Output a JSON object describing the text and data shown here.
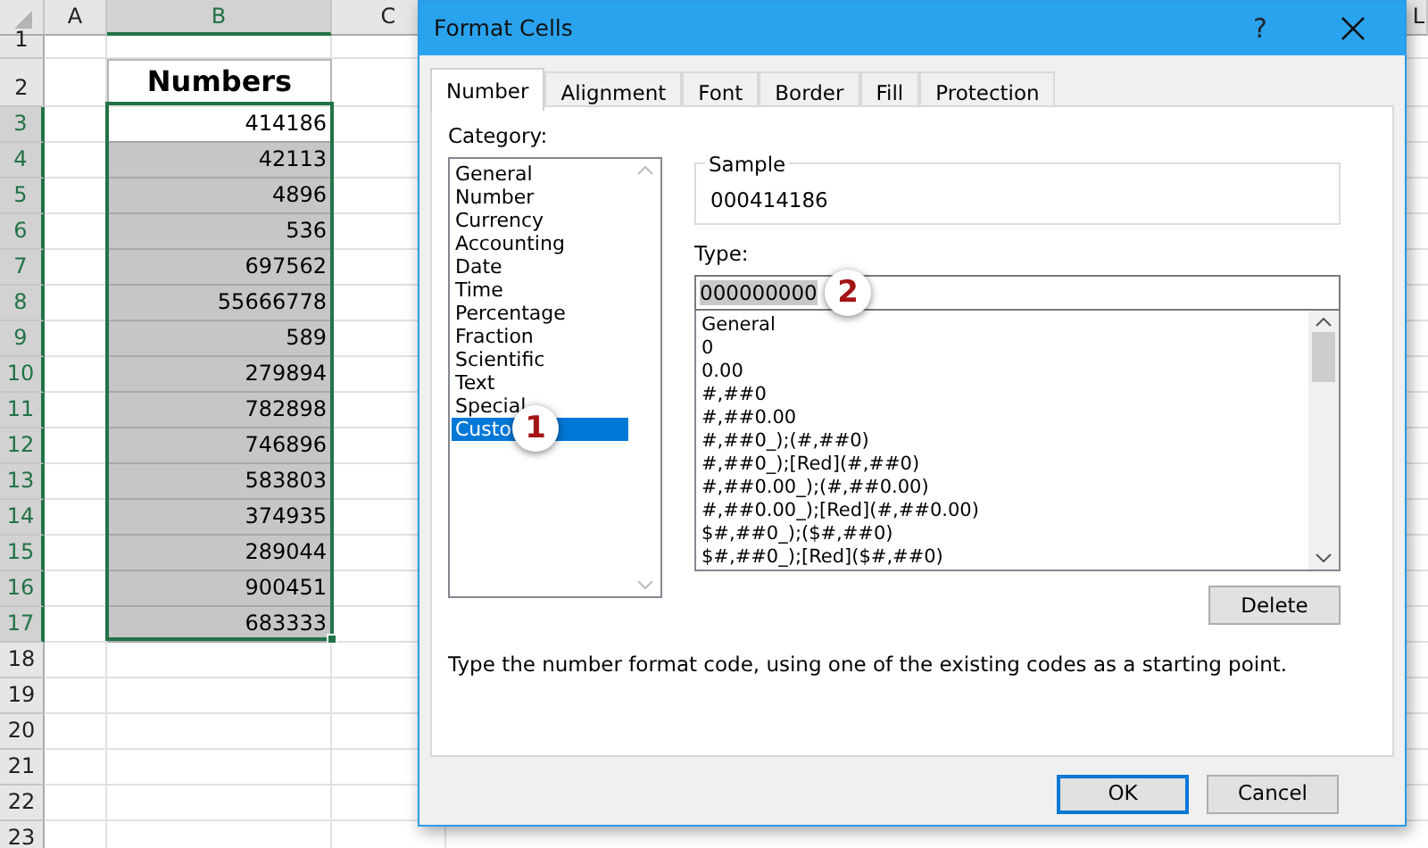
{
  "spreadsheet": {
    "columns": [
      {
        "label": "A",
        "selected": false
      },
      {
        "label": "B",
        "selected": true
      },
      {
        "label": "C",
        "selected": false
      }
    ],
    "edge_column": {
      "label": "L"
    },
    "rows": [
      {
        "label": "1",
        "selected": false
      },
      {
        "label": "2",
        "selected": false
      },
      {
        "label": "3",
        "selected": true
      },
      {
        "label": "4",
        "selected": true
      },
      {
        "label": "5",
        "selected": true
      },
      {
        "label": "6",
        "selected": true
      },
      {
        "label": "7",
        "selected": true
      },
      {
        "label": "8",
        "selected": true
      },
      {
        "label": "9",
        "selected": true
      },
      {
        "label": "10",
        "selected": true
      },
      {
        "label": "11",
        "selected": true
      },
      {
        "label": "12",
        "selected": true
      },
      {
        "label": "13",
        "selected": true
      },
      {
        "label": "14",
        "selected": true
      },
      {
        "label": "15",
        "selected": true
      },
      {
        "label": "16",
        "selected": true
      },
      {
        "label": "17",
        "selected": true
      },
      {
        "label": "18",
        "selected": false
      },
      {
        "label": "19",
        "selected": false
      },
      {
        "label": "20",
        "selected": false
      },
      {
        "label": "21",
        "selected": false
      },
      {
        "label": "22",
        "selected": false
      },
      {
        "label": "23",
        "selected": false
      }
    ],
    "header_cell": "Numbers",
    "values": [
      {
        "text": "414186",
        "active": true
      },
      {
        "text": "42113",
        "active": false
      },
      {
        "text": "4896",
        "active": false
      },
      {
        "text": "536",
        "active": false
      },
      {
        "text": "697562",
        "active": false
      },
      {
        "text": "55666778",
        "active": false
      },
      {
        "text": "589",
        "active": false
      },
      {
        "text": "279894",
        "active": false
      },
      {
        "text": "782898",
        "active": false
      },
      {
        "text": "746896",
        "active": false
      },
      {
        "text": "583803",
        "active": false
      },
      {
        "text": "374935",
        "active": false
      },
      {
        "text": "289044",
        "active": false
      },
      {
        "text": "900451",
        "active": false
      },
      {
        "text": "683333",
        "active": false
      }
    ]
  },
  "dialog": {
    "title": "Format Cells",
    "help": "?",
    "tabs": [
      {
        "label": "Number",
        "selected": true
      },
      {
        "label": "Alignment",
        "selected": false
      },
      {
        "label": "Font",
        "selected": false
      },
      {
        "label": "Border",
        "selected": false
      },
      {
        "label": "Fill",
        "selected": false
      },
      {
        "label": "Protection",
        "selected": false
      }
    ],
    "category_label": "Category:",
    "categories": [
      {
        "label": "General",
        "selected": false
      },
      {
        "label": "Number",
        "selected": false
      },
      {
        "label": "Currency",
        "selected": false
      },
      {
        "label": "Accounting",
        "selected": false
      },
      {
        "label": "Date",
        "selected": false
      },
      {
        "label": "Time",
        "selected": false
      },
      {
        "label": "Percentage",
        "selected": false
      },
      {
        "label": "Fraction",
        "selected": false
      },
      {
        "label": "Scientific",
        "selected": false
      },
      {
        "label": "Text",
        "selected": false
      },
      {
        "label": "Special",
        "selected": false
      },
      {
        "label": "Custo",
        "selected": true,
        "callout": "1"
      }
    ],
    "sample": {
      "label": "Sample",
      "value": "000414186"
    },
    "type": {
      "label": "Type:",
      "value": "000000000",
      "callout": "2"
    },
    "type_list": [
      "General",
      "0",
      "0.00",
      "#,##0",
      "#,##0.00",
      "#,##0_);(#,##0)",
      "#,##0_);[Red](#,##0)",
      "#,##0.00_);(#,##0.00)",
      "#,##0.00_);[Red](#,##0.00)",
      "$#,##0_);($#,##0)",
      "$#,##0_);[Red]($#,##0)"
    ],
    "delete_button": "Delete",
    "hint": "Type the number format code, using one of the existing codes as a starting point.",
    "buttons": [
      {
        "label": "OK",
        "default": true
      },
      {
        "label": "Cancel",
        "default": false
      }
    ]
  }
}
